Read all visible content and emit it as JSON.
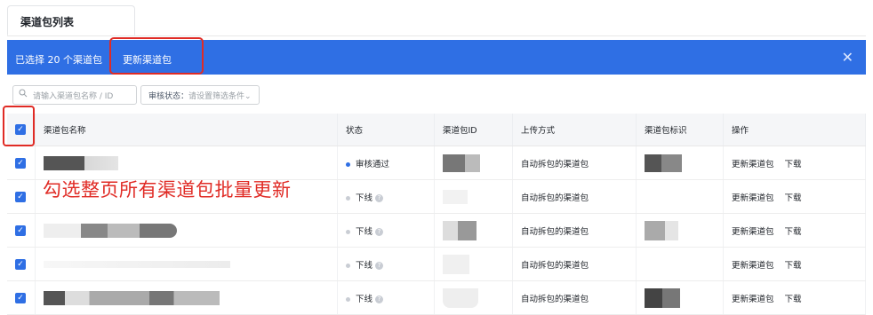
{
  "tab": {
    "title": "渠道包列表"
  },
  "bulk_bar": {
    "selected_text": "已选择 20 个渠道包",
    "update_label": "更新渠道包",
    "close_glyph": "✕"
  },
  "filters": {
    "search_placeholder": "请输入渠道包名称 / ID",
    "status_label": "审核状态：",
    "status_value": "请设置筛选条件",
    "status_arrow": "⌄"
  },
  "table": {
    "headers": [
      "渠道包名称",
      "状态",
      "渠道包ID",
      "上传方式",
      "渠道包标识",
      "操作"
    ],
    "rows": [
      {
        "status": "审核通过",
        "status_color": "#2f6fe4",
        "help": "",
        "upload": "自动拆包的渠道包",
        "op1": "更新渠道包",
        "op2": "下载"
      },
      {
        "status": "下线",
        "status_color": "#c9cdd4",
        "help": "?",
        "upload": "自动拆包的渠道包",
        "op1": "更新渠道包",
        "op2": "下载"
      },
      {
        "status": "下线",
        "status_color": "#c9cdd4",
        "help": "?",
        "upload": "自动拆包的渠道包",
        "op1": "更新渠道包",
        "op2": "下载"
      },
      {
        "status": "下线",
        "status_color": "#c9cdd4",
        "help": "?",
        "upload": "自动拆包的渠道包",
        "op1": "更新渠道包",
        "op2": "下载"
      },
      {
        "status": "下线",
        "status_color": "#c9cdd4",
        "help": "?",
        "upload": "自动拆包的渠道包",
        "op1": "更新渠道包",
        "op2": "下载"
      }
    ]
  },
  "annotation": {
    "text": "勾选整页所有渠道包批量更新",
    "color": "#e02b25"
  },
  "colors": {
    "primary": "#2f6fe4",
    "highlight": "#e02b25"
  },
  "icons": {
    "checkbox": "✓"
  }
}
